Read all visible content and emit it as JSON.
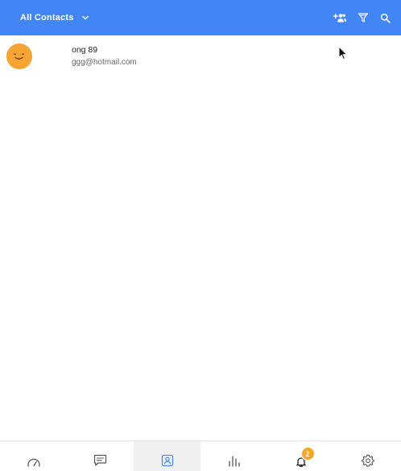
{
  "header": {
    "filter_label": "All Contacts",
    "background": "#4285f4",
    "actions": [
      "add-contact-icon",
      "filter-icon",
      "search-icon"
    ]
  },
  "contacts": [
    {
      "name": "ong 89",
      "email": "ggg@hotmail.com",
      "avatar_color": "#f6a534"
    }
  ],
  "bottom_nav": {
    "items": [
      "dashboard-icon",
      "chat-icon",
      "contacts-icon",
      "reports-icon",
      "notifications-icon",
      "settings-icon"
    ],
    "active": "contacts-icon",
    "notifications_badge": "2",
    "badge_color": "#f5a623"
  }
}
